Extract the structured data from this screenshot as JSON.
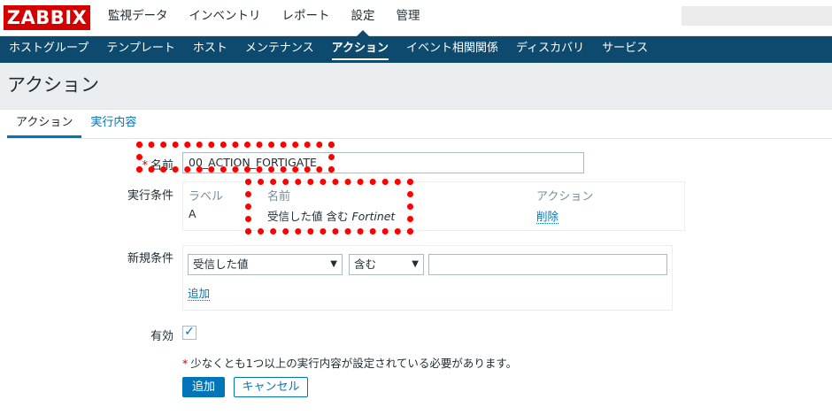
{
  "topbar": {
    "logo": "ZABBIX",
    "nav": [
      "監視データ",
      "インベントリ",
      "レポート",
      "設定",
      "管理"
    ],
    "active": "設定"
  },
  "subnav": {
    "items": [
      "ホストグループ",
      "テンプレート",
      "ホスト",
      "メンテナンス",
      "アクション",
      "イベント相関関係",
      "ディスカバリ",
      "サービス"
    ],
    "active": "アクション"
  },
  "page": {
    "title": "アクション"
  },
  "tabs": [
    "アクション",
    "実行内容"
  ],
  "form": {
    "name_label": "名前",
    "name_required": "*",
    "name_value": "00_ACTION_FORTIGATE",
    "conditions_label": "実行条件",
    "conditions_headers": {
      "label": "ラベル",
      "name": "名前",
      "action": "アクション"
    },
    "conditions_rows": [
      {
        "label": "A",
        "name_prefix": "受信した値 含む",
        "name_value": "Fortinet",
        "action": "削除"
      }
    ],
    "new_condition_label": "新規条件",
    "new_condition_type": "受信した値",
    "new_condition_operator": "含む",
    "new_condition_value": "",
    "new_condition_add": "追加",
    "enabled_label": "有効",
    "enabled_checked": true,
    "note_star": "*",
    "note": "少なくとも1つ以上の実行内容が設定されている必要があります。",
    "add_button": "追加",
    "cancel_button": "キャンセル"
  },
  "colors": {
    "logo_bg": "#d40000",
    "subnav_bg": "#0e4a6d",
    "link": "#0275b8",
    "highlight": "#ff0000"
  }
}
